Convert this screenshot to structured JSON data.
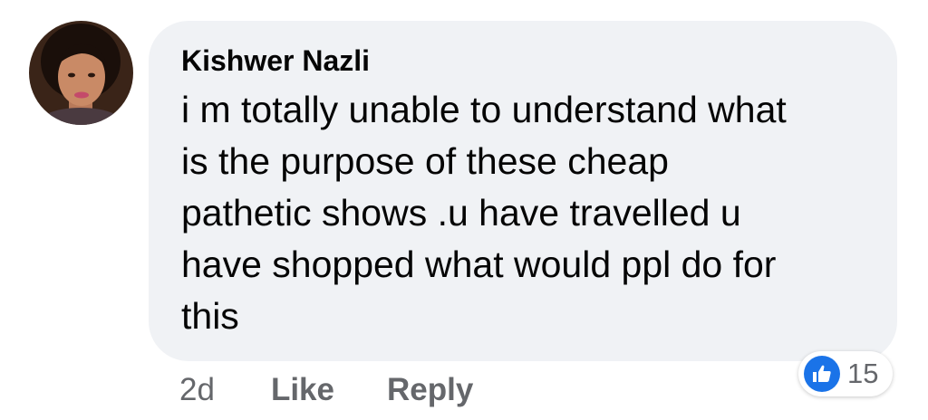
{
  "comment": {
    "author": "Kishwer Nazli",
    "text_lines": [
      "i m totally unable to understand what",
      "is the purpose of these cheap",
      "pathetic shows .u have travelled u",
      "have shopped what would ppl do for",
      "this"
    ]
  },
  "actions": {
    "timestamp": "2d",
    "like_label": "Like",
    "reply_label": "Reply"
  },
  "reactions": {
    "icon": "thumbs-up-icon",
    "count": "15",
    "color": "#1a73e8"
  },
  "colors": {
    "bubble": "#f0f2f5",
    "text": "#050505",
    "secondary_text": "#65676b"
  }
}
